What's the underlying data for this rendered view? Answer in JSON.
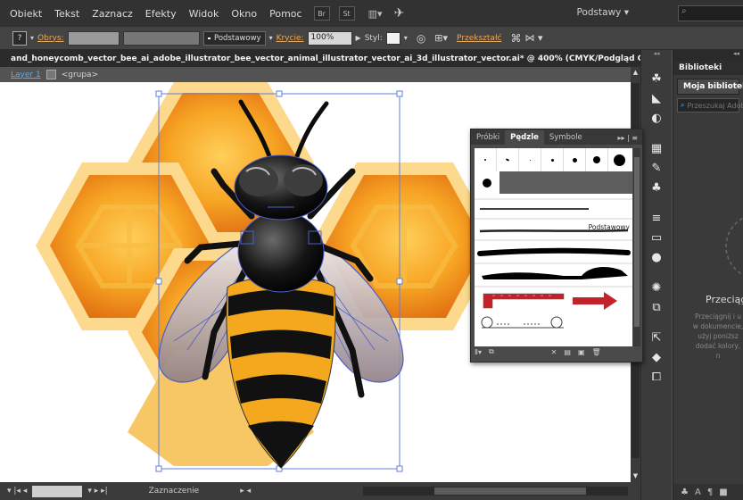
{
  "menu": [
    "Obiekt",
    "Tekst",
    "Zaznacz",
    "Efekty",
    "Widok",
    "Okno",
    "Pomoc"
  ],
  "menu_badges": [
    "Br",
    "St"
  ],
  "workspace_label": "Podstawy",
  "control": {
    "stroke_label": "Obrys:",
    "stroke_profile": "Podstawowy",
    "opacity_label": "Krycie:",
    "opacity_value": "100%",
    "style_label": "Styl:",
    "transform_link": "Przekształć"
  },
  "document_tab": {
    "title": "and_honeycomb_vector_bee_ai_adobe_illustrator_bee_vector_animal_illustrator_vector_ai_3d_illustrator_vector.ai* @ 400% (CMYK/Podgląd GPU)",
    "close": "×"
  },
  "breadcrumb": {
    "layer": "Layer 1",
    "group": "<grupa>"
  },
  "status": {
    "mode": "Zaznaczenie"
  },
  "brushes_panel": {
    "tabs": [
      "Próbki",
      "Pędzle",
      "Symbole"
    ],
    "active_tab": "Pędzle",
    "basic_brush_label": "Podstawowy",
    "menu_glyph": "▸▸ | ≡"
  },
  "library_panel": {
    "tab": "Biblioteki",
    "selected_library": "Moja biblioteka",
    "search_placeholder": "Przeszukaj Adob",
    "empty_title": "Przeciągnij",
    "empty_text": [
      "Przeciągnij i u",
      "w dokumencie,",
      "użyj poniższ",
      "dodać kolory,",
      "n"
    ]
  },
  "colors": {
    "accent_link": "#e8a95a",
    "layer_link": "#4fb1ff",
    "honey_light": "#fcd98c",
    "honey_mid": "#f5a623",
    "honey_dark": "#e07b13",
    "bee_yellow": "#f4a81d"
  }
}
